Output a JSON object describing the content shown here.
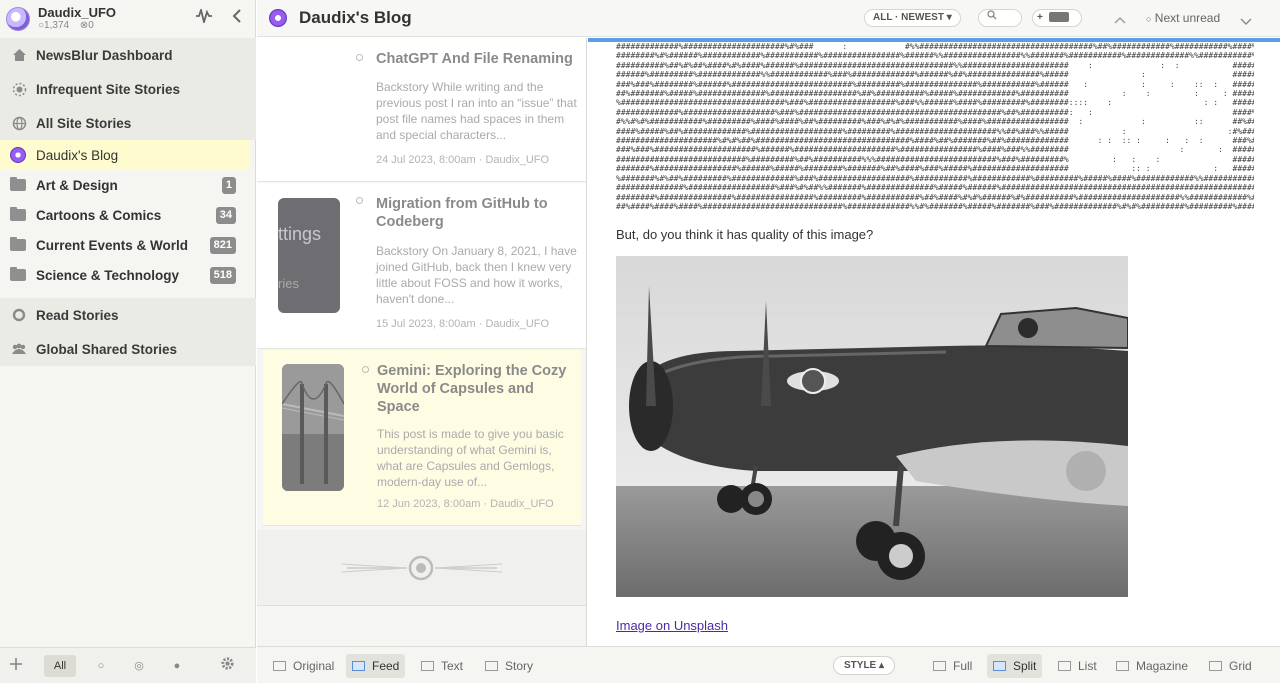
{
  "user": {
    "name": "Daudix_UFO",
    "unread_count": "1,374",
    "starred_count": "0"
  },
  "nav": {
    "dashboard": "NewsBlur Dashboard",
    "infrequent": "Infrequent Site Stories",
    "all_site": "All Site Stories",
    "read": "Read Stories",
    "global_shared": "Global Shared Stories"
  },
  "feeds": [
    {
      "label": "Daudix's Blog",
      "count": ""
    },
    {
      "label": "Art & Design",
      "count": "1"
    },
    {
      "label": "Cartoons & Comics",
      "count": "34"
    },
    {
      "label": "Current Events & World",
      "count": "821"
    },
    {
      "label": "Science & Technology",
      "count": "518"
    }
  ],
  "sidebar_footer": {
    "filter_all": "All"
  },
  "topbar": {
    "feed_title": "Daudix's Blog",
    "sort_order": "ALL · NEWEST",
    "next_unread": "Next unread"
  },
  "stories": [
    {
      "title": "ChatGPT And File Renaming",
      "snippet": "Backstory While writing and the previous post I ran into an “issue” that post file names had spaces in them and special characters...",
      "meta": "24 Jul 2023, 8:00am · Daudix_UFO"
    },
    {
      "title": "Migration from GitHub to Codeberg",
      "snippet": "Backstory On January 8, 2021, I have joined GitHub, back then I knew very little about FOSS and how it works, haven't done...",
      "meta": "15 Jul 2023, 8:00am · Daudix_UFO",
      "thumb_text_1": "ttings",
      "thumb_text_2": "ries"
    },
    {
      "title": "Gemini: Exploring the Cozy World of Capsules and Space",
      "snippet": "This post is made to give you basic understanding of what Gemini is, what are Capsules and Gemlogs, modern-day use of...",
      "meta": "12 Jun 2023, 8:00am · Daudix_UFO"
    }
  ],
  "story_pane": {
    "question": "But, do you think it has quality of this image?",
    "image_link": "Image on Unsplash"
  },
  "bottombar": {
    "original": "Original",
    "feed": "Feed",
    "text": "Text",
    "story": "Story",
    "style": "STYLE",
    "full": "Full",
    "split": "Split",
    "list": "List",
    "magazine": "Magazine",
    "grid": "Grid"
  },
  "colors": {
    "selected_bg": "#fefde3",
    "accent_blue": "#5a9ee6",
    "link": "#4b2aa6",
    "badge": "#8c8c8c"
  }
}
